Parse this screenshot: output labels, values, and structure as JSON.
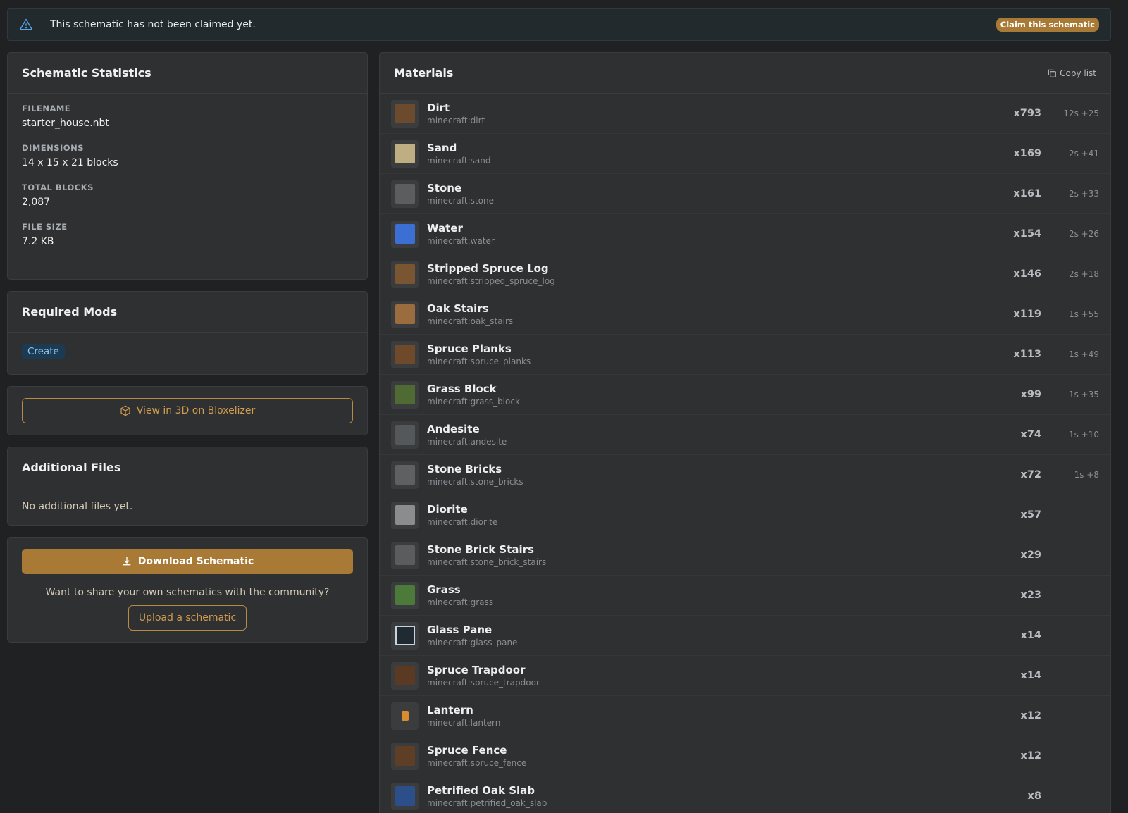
{
  "banner": {
    "message": "This schematic has not been claimed yet.",
    "claim_label": "Claim this schematic"
  },
  "stats": {
    "title": "Schematic Statistics",
    "items": [
      {
        "label": "FILENAME",
        "value": "starter_house.nbt"
      },
      {
        "label": "DIMENSIONS",
        "value": "14 x 15 x 21 blocks"
      },
      {
        "label": "TOTAL BLOCKS",
        "value": "2,087"
      },
      {
        "label": "FILE SIZE",
        "value": "7.2 KB"
      }
    ]
  },
  "mods": {
    "title": "Required Mods",
    "items": [
      "Create"
    ]
  },
  "viewer": {
    "label": "View in 3D on Bloxelizer"
  },
  "files": {
    "title": "Additional Files",
    "empty": "No additional files yet."
  },
  "download": {
    "label": "Download Schematic",
    "share_text": "Want to share your own schematics with the community?",
    "upload_label": "Upload a schematic"
  },
  "materials": {
    "title": "Materials",
    "copy_label": "Copy list",
    "items": [
      {
        "name": "Dirt",
        "id": "minecraft:dirt",
        "count": "x793",
        "stack": "12s +25",
        "color": "#6b4a2e"
      },
      {
        "name": "Sand",
        "id": "minecraft:sand",
        "count": "x169",
        "stack": "2s +41",
        "color": "#bfae82"
      },
      {
        "name": "Stone",
        "id": "minecraft:stone",
        "count": "x161",
        "stack": "2s +33",
        "color": "#5b5d5f"
      },
      {
        "name": "Water",
        "id": "minecraft:water",
        "count": "x154",
        "stack": "2s +26",
        "color": "#3b6fd4"
      },
      {
        "name": "Stripped Spruce Log",
        "id": "minecraft:stripped_spruce_log",
        "count": "x146",
        "stack": "2s +18",
        "color": "#7a5532"
      },
      {
        "name": "Oak Stairs",
        "id": "minecraft:oak_stairs",
        "count": "x119",
        "stack": "1s +55",
        "color": "#9a6c3e"
      },
      {
        "name": "Spruce Planks",
        "id": "minecraft:spruce_planks",
        "count": "x113",
        "stack": "1s +49",
        "color": "#6e4a2a"
      },
      {
        "name": "Grass Block",
        "id": "minecraft:grass_block",
        "count": "x99",
        "stack": "1s +35",
        "color": "#4f6b33"
      },
      {
        "name": "Andesite",
        "id": "minecraft:andesite",
        "count": "x74",
        "stack": "1s +10",
        "color": "#55585a"
      },
      {
        "name": "Stone Bricks",
        "id": "minecraft:stone_bricks",
        "count": "x72",
        "stack": "1s +8",
        "color": "#5e6062"
      },
      {
        "name": "Diorite",
        "id": "minecraft:diorite",
        "count": "x57",
        "stack": "",
        "color": "#8a8c8d"
      },
      {
        "name": "Stone Brick Stairs",
        "id": "minecraft:stone_brick_stairs",
        "count": "x29",
        "stack": "",
        "color": "#5a5c5e"
      },
      {
        "name": "Grass",
        "id": "minecraft:grass",
        "count": "x23",
        "stack": "",
        "color": "#4b7a3a"
      },
      {
        "name": "Glass Pane",
        "id": "minecraft:glass_pane",
        "count": "x14",
        "stack": "",
        "color": "#1f2a33"
      },
      {
        "name": "Spruce Trapdoor",
        "id": "minecraft:spruce_trapdoor",
        "count": "x14",
        "stack": "",
        "color": "#5a3a22"
      },
      {
        "name": "Lantern",
        "id": "minecraft:lantern",
        "count": "x12",
        "stack": "",
        "color": "#d88b2f"
      },
      {
        "name": "Spruce Fence",
        "id": "minecraft:spruce_fence",
        "count": "x12",
        "stack": "",
        "color": "#5e3f25"
      },
      {
        "name": "Petrified Oak Slab",
        "id": "minecraft:petrified_oak_slab",
        "count": "x8",
        "stack": "",
        "color": "#2c4f8a"
      }
    ]
  }
}
